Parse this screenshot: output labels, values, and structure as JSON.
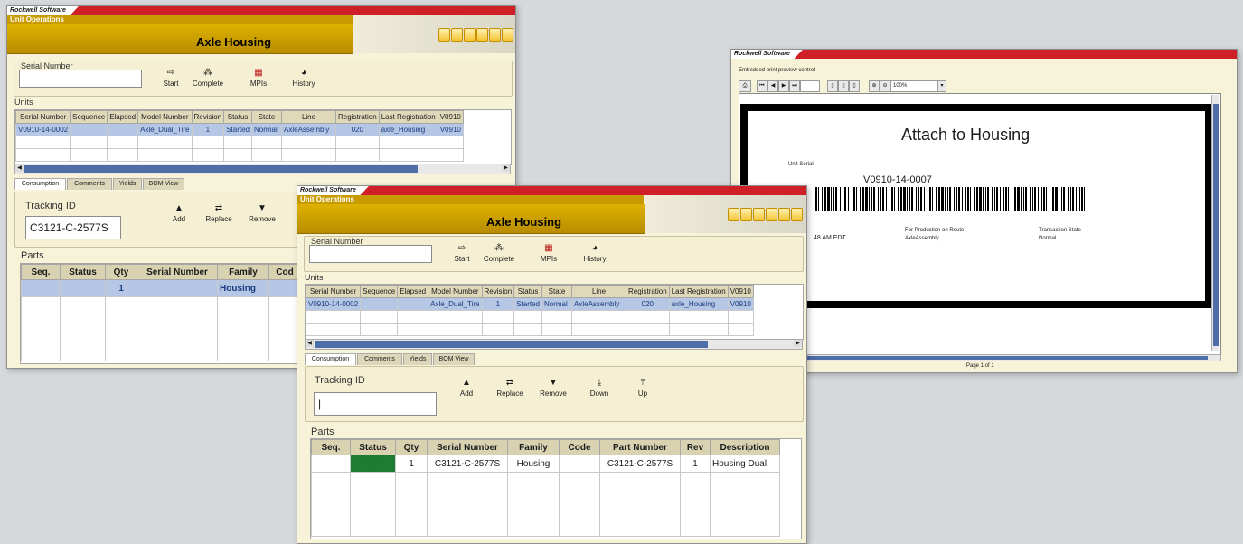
{
  "brand": "Rockwell Software",
  "unit_ops_label": "Unit Operations",
  "title": "Axle Housing",
  "serial_group_label": "Serial Number",
  "toolbar1": [
    "Start",
    "Complete",
    "MPIs",
    "History"
  ],
  "units_label": "Units",
  "units_headers": [
    "Serial Number",
    "Sequence",
    "Elapsed",
    "Model Number",
    "Revision",
    "Status",
    "State",
    "Line",
    "Registration",
    "Last Registration",
    "V0910"
  ],
  "units_row": [
    "V0910-14-0002",
    "",
    "",
    "Axle_Dual_Tire",
    "1",
    "Started",
    "Normal",
    "AxleAssembly",
    "020",
    "axle_Housing",
    "V0910"
  ],
  "tabs": [
    "Consumption",
    "Comments",
    "Yields",
    "BOM View"
  ],
  "tracking_label": "Tracking ID",
  "win1_tracking_value": "C3121-C-2577S",
  "win1_toolbar2": [
    "Add",
    "Replace",
    "Remove"
  ],
  "win2_toolbar2": [
    "Add",
    "Replace",
    "Remove",
    "Down",
    "Up"
  ],
  "parts_label": "Parts",
  "parts_headers_win1": [
    "Seq.",
    "Status",
    "Qty",
    "Serial Number",
    "Family",
    "Cod"
  ],
  "parts_row_win1": [
    "",
    "",
    "1",
    "",
    "Housing",
    ""
  ],
  "parts_headers_win2": [
    "Seq.",
    "Status",
    "Qty",
    "Serial Number",
    "Family",
    "Code",
    "Part Number",
    "Rev",
    "Description"
  ],
  "parts_row_win2": [
    "",
    "OK",
    "1",
    "C3121-C-2577S",
    "Housing",
    "",
    "C3121-C-2577S",
    "1",
    "Housing Dual"
  ],
  "colors": {
    "red": "#cf2027",
    "gold": "#d4a600",
    "ok_green": "#1d7b32",
    "sel": "#b6c7e6"
  },
  "print": {
    "caption": "Embedded print preview control",
    "zoom": "100%",
    "label_title": "Attach to Housing",
    "unit_serial_label": "Unit Serial",
    "unit_serial_value": "V0910-14-0007",
    "time_fragment": "48 AM EDT",
    "route_label": "For Production on Route",
    "route_value": "AxleAssembly",
    "state_label": "Transaction State",
    "state_value": "Normal",
    "page_text": "Page 1 of 1"
  }
}
